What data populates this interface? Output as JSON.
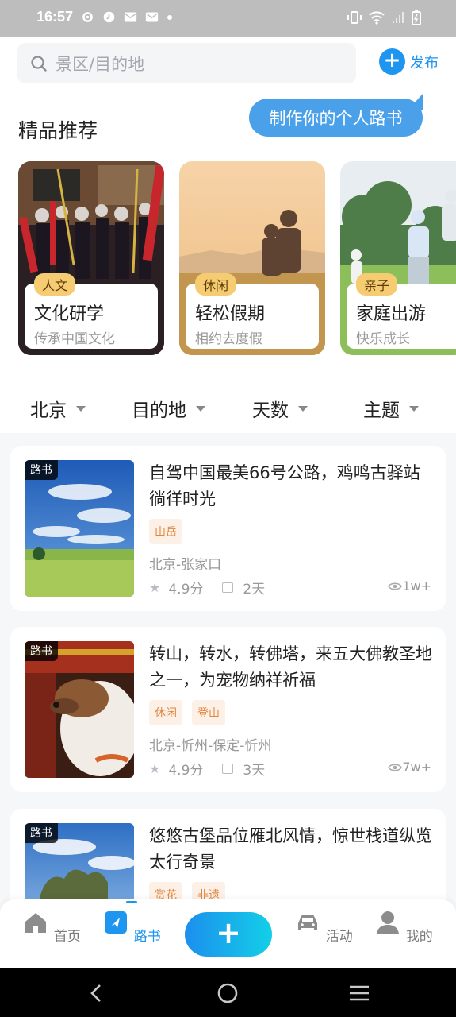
{
  "status_bar": {
    "time": "16:57"
  },
  "search": {
    "placeholder": "景区/目的地"
  },
  "publish": {
    "plus": "+",
    "label": "发布"
  },
  "section_title": "精品推荐",
  "bubble": "制作你的个人路书",
  "featured": [
    {
      "tag": "人文",
      "title": "文化研学",
      "subtitle": "传承中国文化"
    },
    {
      "tag": "休闲",
      "title": "轻松假期",
      "subtitle": "相约去度假"
    },
    {
      "tag": "亲子",
      "title": "家庭出游",
      "subtitle": "快乐成长"
    }
  ],
  "filters": [
    "北京",
    "目的地",
    "天数",
    "主题"
  ],
  "items": [
    {
      "badge": "路书",
      "title": "自驾中国最美66号公路，鸡鸣古驿站徜徉时光",
      "tags": [
        "山岳"
      ],
      "route": "北京-张家口",
      "rating": "4.9分",
      "days": "2天",
      "views": "1w+"
    },
    {
      "badge": "路书",
      "title": "转山，转水，转佛塔，来五大佛教圣地之一，为宠物纳祥祈福",
      "tags": [
        "休闲",
        "登山"
      ],
      "route": "北京-忻州-保定-忻州",
      "rating": "4.9分",
      "days": "3天",
      "views": "7w+"
    },
    {
      "badge": "路书",
      "title": "悠悠古堡品位雁北风情，惊世栈道纵览太行奇景",
      "tags": [
        "赏花",
        "非遗"
      ],
      "route": "",
      "rating": "",
      "days": "",
      "views": ""
    }
  ],
  "nav": {
    "home": "首页",
    "roadbook": "路书",
    "plus": "+",
    "activity": "活动",
    "mine": "我的"
  },
  "colors": {
    "accent": "#1e95ef",
    "bubble": "#4aa1ea",
    "tag_bg": "#fdf0e7",
    "tag_text": "#e0873f",
    "featured_tag": "#f6cc72"
  }
}
